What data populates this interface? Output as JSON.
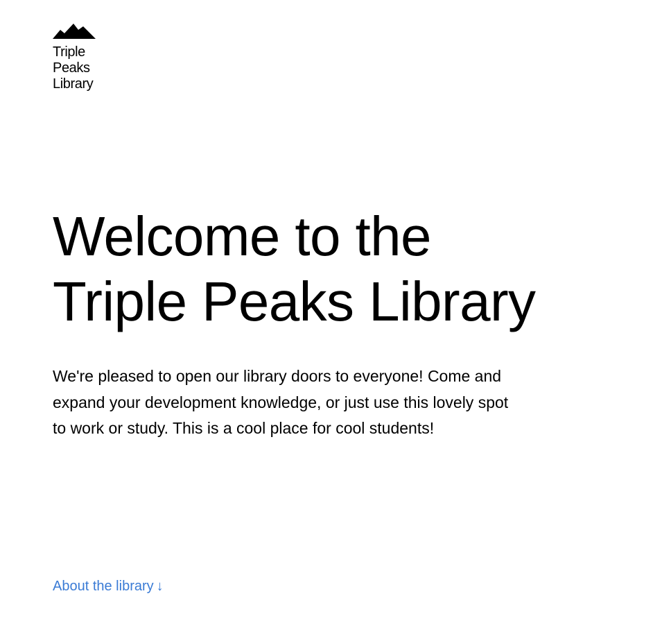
{
  "header": {
    "logo": {
      "icon": "three-peaks-logo-icon",
      "text": "Triple\nPeaks\nLibrary"
    }
  },
  "hero": {
    "title": "Welcome to the\nTriple Peaks Library",
    "description": "We're pleased to open our library doors to everyone! Come and expand your development knowledge, or just use this lovely spot to work or study. This is a cool place for cool students!",
    "link": {
      "label": "About the library",
      "arrow": "↓"
    }
  },
  "colors": {
    "text": "#000000",
    "link": "#3a7bd5",
    "background": "#ffffff"
  }
}
